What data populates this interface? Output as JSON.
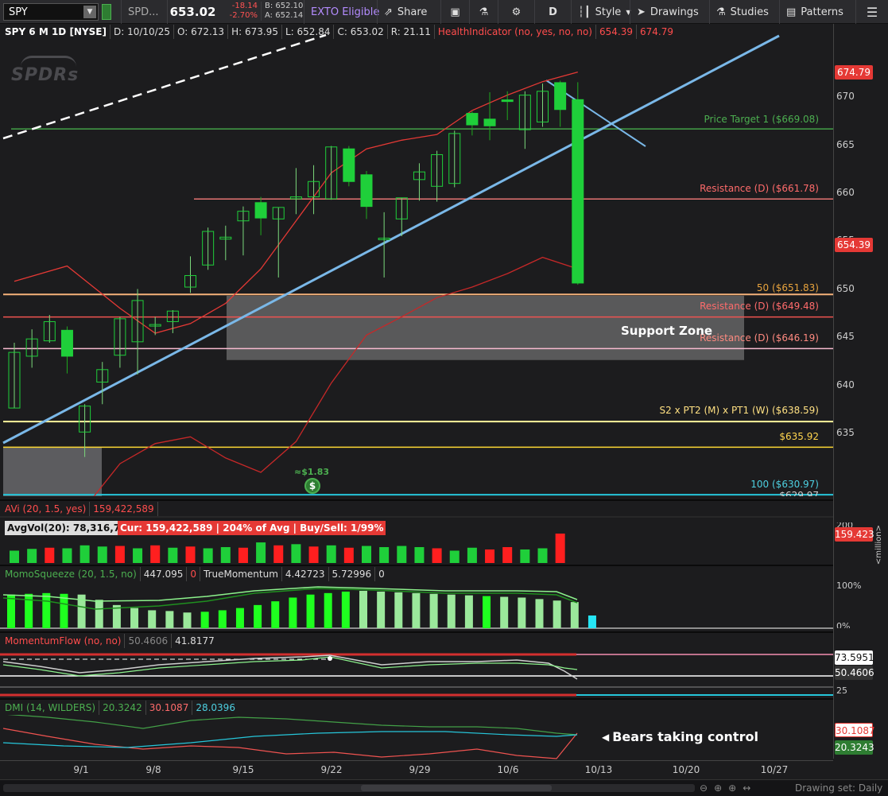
{
  "toolbar": {
    "symbol": "SPY",
    "description": "SPD...",
    "change": "-18.14",
    "change_pct": "-2.70%",
    "last": "653.02",
    "bid": "B: 652.10",
    "ask": "A: 652.14",
    "exto": "EXTO Eligible",
    "share": "Share",
    "aggregation": "D",
    "style": "Style",
    "drawings": "Drawings",
    "studies": "Studies",
    "patterns": "Patterns"
  },
  "main_header": {
    "title": "SPY 6 M 1D [NYSE]",
    "date": "D: 10/10/25",
    "open": "O: 672.13",
    "high": "H: 673.95",
    "low": "L: 652.84",
    "close": "C: 653.02",
    "range": "R: 21.11",
    "indicator": "HealthIndicator (no, yes, no, no)",
    "ind_v1": "654.39",
    "ind_v2": "674.79"
  },
  "logo_text": "SPDRs",
  "levels": {
    "price_target": "Price Target 1 ($669.08)",
    "res1": "Resistance (D) ($661.78)",
    "fib50": "50 ($651.83)",
    "res2": "Resistance (D) ($649.48)",
    "res3": "Resistance (D) ($646.19)",
    "support_zone": "Support Zone",
    "s2": "S2 x PT2 (M) x PT1 (W) ($638.59)",
    "l635": "$635.92",
    "l100": "100 ($630.97)",
    "l_cut": "$629.97"
  },
  "dividend": {
    "label": "≈$1.83",
    "icon": "dollar-icon"
  },
  "price_axis": {
    "ticks": [
      "670",
      "665",
      "660",
      "655",
      "650",
      "645",
      "640",
      "635"
    ],
    "badge_high": "674.79",
    "badge_last": "654.39"
  },
  "volume": {
    "header_name": "AVi (20, 1.5, yes)",
    "header_value": "159,422,589",
    "avgvol": "AvgVol(20): 78,316,795",
    "cur": "Cur: 159,422,589 | 204% of Avg | Buy/Sell: 1/99%",
    "badge": "159.423",
    "tick_top": "200",
    "units": "<million>",
    "bars": [
      {
        "v": 0.42,
        "up": true
      },
      {
        "v": 0.48,
        "up": true
      },
      {
        "v": 0.52,
        "up": false
      },
      {
        "v": 0.5,
        "up": true
      },
      {
        "v": 0.6,
        "up": true
      },
      {
        "v": 0.56,
        "up": true
      },
      {
        "v": 0.58,
        "up": false
      },
      {
        "v": 0.5,
        "up": true
      },
      {
        "v": 0.6,
        "up": false
      },
      {
        "v": 0.52,
        "up": true
      },
      {
        "v": 0.56,
        "up": false
      },
      {
        "v": 0.5,
        "up": true
      },
      {
        "v": 0.54,
        "up": true
      },
      {
        "v": 0.52,
        "up": false
      },
      {
        "v": 0.7,
        "up": true
      },
      {
        "v": 0.6,
        "up": false
      },
      {
        "v": 0.64,
        "up": true
      },
      {
        "v": 0.56,
        "up": false
      },
      {
        "v": 0.6,
        "up": true
      },
      {
        "v": 0.52,
        "up": false
      },
      {
        "v": 0.58,
        "up": true
      },
      {
        "v": 0.54,
        "up": true
      },
      {
        "v": 0.58,
        "up": true
      },
      {
        "v": 0.54,
        "up": true
      },
      {
        "v": 0.5,
        "up": false
      },
      {
        "v": 0.42,
        "up": true
      },
      {
        "v": 0.52,
        "up": true
      },
      {
        "v": 0.46,
        "up": false
      },
      {
        "v": 0.54,
        "up": false
      },
      {
        "v": 0.46,
        "up": true
      },
      {
        "v": 0.5,
        "up": true
      },
      {
        "v": 1.0,
        "up": false
      }
    ]
  },
  "momo": {
    "name": "MomoSqueeze (20, 1.5, no)",
    "v1": "447.095",
    "v2": "0",
    "tm_name": "TrueMomentum",
    "tm1": "4.42723",
    "tm2": "5.72996",
    "tm3": "0",
    "tick_top": "100%",
    "tick_bot": "0%",
    "bars": [
      0.9,
      0.92,
      0.94,
      0.92,
      0.9,
      0.76,
      0.62,
      0.54,
      0.48,
      0.46,
      0.42,
      0.44,
      0.48,
      0.54,
      0.62,
      0.72,
      0.82,
      0.9,
      0.94,
      0.98,
      1.0,
      0.98,
      0.96,
      0.94,
      0.92,
      0.9,
      0.88,
      0.86,
      0.84,
      0.82,
      0.78,
      0.74,
      0.7,
      0.34
    ],
    "bright": [
      0,
      1,
      2,
      3,
      11,
      12,
      13,
      14,
      15,
      16,
      17,
      18,
      19,
      27
    ]
  },
  "mflow": {
    "name": "MomentumFlow (no, no)",
    "v1": "50.4606",
    "v2": "41.8177",
    "badge1": "73.5951",
    "badge2": "50.4606",
    "tick": "25"
  },
  "dmi": {
    "name": "DMI (14, WILDERS)",
    "v1": "20.3242",
    "v2": "30.1087",
    "v3": "28.0396",
    "note": "Bears taking control",
    "badge_red": "30.1087",
    "badge_green": "20.3243"
  },
  "xaxis": {
    "labels": [
      "9/1",
      "9/8",
      "9/15",
      "9/22",
      "9/29",
      "10/6",
      "10/13",
      "10/20",
      "10/27"
    ]
  },
  "footer": {
    "drawing_set": "Drawing set: Daily"
  },
  "chart_data": {
    "type": "candlestick",
    "title": "SPY 6 M 1D [NYSE]",
    "y_ticks": [
      635,
      640,
      645,
      650,
      655,
      660,
      665,
      670
    ],
    "ylim": [
      630.5,
      677
    ],
    "x_labels": [
      "9/1",
      "9/8",
      "9/15",
      "9/22",
      "9/29",
      "10/6",
      "10/13",
      "10/20",
      "10/27"
    ],
    "candles": [
      {
        "o": 640.0,
        "h": 646.8,
        "l": 640.0,
        "c": 645.8
      },
      {
        "o": 645.4,
        "h": 648.2,
        "l": 644.2,
        "c": 647.2
      },
      {
        "o": 647.0,
        "h": 649.7,
        "l": 646.8,
        "c": 649.0
      },
      {
        "o": 648.1,
        "h": 648.5,
        "l": 643.6,
        "c": 645.4
      },
      {
        "o": 637.5,
        "h": 640.4,
        "l": 634.9,
        "c": 640.2
      },
      {
        "o": 642.7,
        "h": 644.8,
        "l": 640.4,
        "c": 644.0
      },
      {
        "o": 645.5,
        "h": 649.5,
        "l": 644.2,
        "c": 649.3
      },
      {
        "o": 646.9,
        "h": 652.4,
        "l": 643.5,
        "c": 651.2
      },
      {
        "o": 648.6,
        "h": 649.5,
        "l": 647.6,
        "c": 648.7
      },
      {
        "o": 649.0,
        "h": 650.2,
        "l": 647.8,
        "c": 650.1
      },
      {
        "o": 652.6,
        "h": 655.8,
        "l": 652.0,
        "c": 653.8
      },
      {
        "o": 654.9,
        "h": 658.8,
        "l": 654.4,
        "c": 658.4
      },
      {
        "o": 657.6,
        "h": 659.0,
        "l": 655.4,
        "c": 657.8
      },
      {
        "o": 659.5,
        "h": 661.0,
        "l": 655.9,
        "c": 660.5
      },
      {
        "o": 661.4,
        "h": 662.0,
        "l": 658.0,
        "c": 659.8
      },
      {
        "o": 659.7,
        "h": 660.9,
        "l": 653.6,
        "c": 660.9
      },
      {
        "o": 661.8,
        "h": 665.0,
        "l": 660.2,
        "c": 662.0
      },
      {
        "o": 662.0,
        "h": 665.3,
        "l": 660.2,
        "c": 663.6
      },
      {
        "o": 661.8,
        "h": 667.3,
        "l": 661.7,
        "c": 667.2
      },
      {
        "o": 667.0,
        "h": 667.3,
        "l": 663.1,
        "c": 663.6
      },
      {
        "o": 664.3,
        "h": 664.7,
        "l": 659.7,
        "c": 661.0
      },
      {
        "o": 657.7,
        "h": 660.4,
        "l": 653.6,
        "c": 657.7
      },
      {
        "o": 659.7,
        "h": 661.9,
        "l": 657.9,
        "c": 661.9
      },
      {
        "o": 663.8,
        "h": 665.5,
        "l": 661.6,
        "c": 664.6
      },
      {
        "o": 663.1,
        "h": 666.8,
        "l": 661.5,
        "c": 666.4
      },
      {
        "o": 663.4,
        "h": 668.9,
        "l": 663.0,
        "c": 668.6
      },
      {
        "o": 670.7,
        "h": 670.9,
        "l": 668.4,
        "c": 669.5
      },
      {
        "o": 670.1,
        "h": 672.9,
        "l": 667.9,
        "c": 669.4
      },
      {
        "o": 672.1,
        "h": 673.0,
        "l": 670.0,
        "c": 672.0
      },
      {
        "o": 669.0,
        "h": 673.0,
        "l": 667.0,
        "c": 672.6
      },
      {
        "o": 669.8,
        "h": 673.8,
        "l": 669.3,
        "c": 673.0
      },
      {
        "o": 673.9,
        "h": 674.1,
        "l": 669.3,
        "c": 671.1
      },
      {
        "o": 672.13,
        "h": 673.95,
        "l": 652.84,
        "c": 653.02
      }
    ],
    "health_line": [
      [
        0,
        653.2
      ],
      [
        3,
        654.8
      ],
      [
        6,
        650.4
      ],
      [
        8,
        647.8
      ],
      [
        10,
        648.8
      ],
      [
        12,
        650.9
      ],
      [
        14,
        654.5
      ],
      [
        16,
        659.5
      ],
      [
        18,
        664.5
      ],
      [
        20,
        667.0
      ],
      [
        22,
        667.9
      ],
      [
        24,
        668.5
      ],
      [
        26,
        671.0
      ],
      [
        28,
        672.6
      ],
      [
        30,
        674.0
      ],
      [
        32,
        675.0
      ]
    ],
    "lower_line": [
      [
        0,
        623.0
      ],
      [
        2,
        628.0
      ],
      [
        4,
        629.6
      ],
      [
        6,
        634.2
      ],
      [
        8,
        636.3
      ],
      [
        10,
        637.0
      ],
      [
        12,
        634.8
      ],
      [
        14,
        633.3
      ],
      [
        16,
        636.5
      ],
      [
        18,
        642.6
      ],
      [
        20,
        647.6
      ],
      [
        22,
        649.5
      ],
      [
        24,
        651.5
      ],
      [
        26,
        652.6
      ],
      [
        28,
        654.0
      ],
      [
        30,
        655.7
      ],
      [
        32,
        654.5
      ]
    ],
    "levels": [
      669.08,
      661.78,
      651.83,
      649.48,
      646.19,
      638.59,
      635.92,
      630.97
    ],
    "support_zone": [
      645.0,
      651.7
    ]
  }
}
